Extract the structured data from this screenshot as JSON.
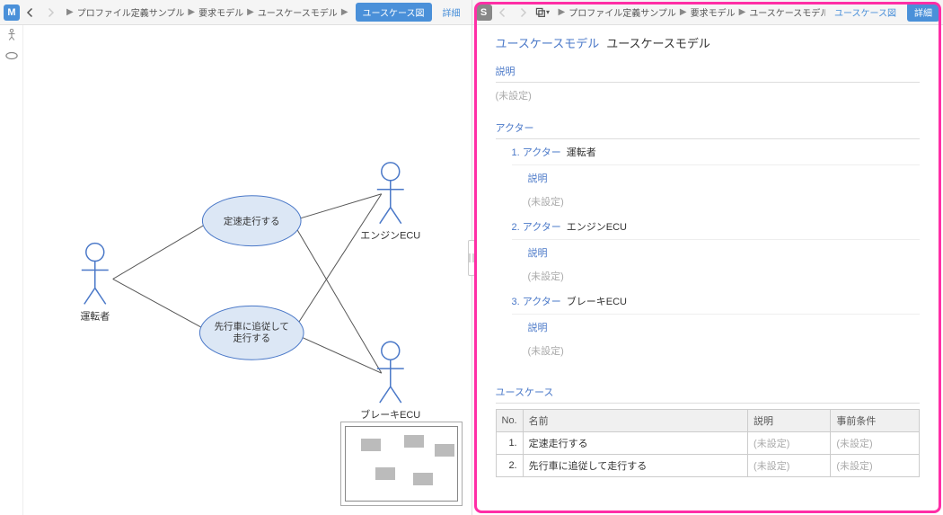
{
  "left": {
    "badge": "M",
    "breadcrumb": [
      "プロファイル定義サンプル",
      "要求モデル",
      "ユースケースモデル"
    ],
    "tab_usecase": "ユースケース図",
    "tab_detail": "詳細",
    "tab_active": "usecase"
  },
  "right": {
    "badge": "S",
    "breadcrumb": [
      "プロファイル定義サンプル",
      "要求モデル",
      "ユースケースモデル"
    ],
    "tab_usecase": "ユースケース図",
    "tab_detail": "詳細",
    "tab_active": "detail"
  },
  "diagram": {
    "actor1": "運転者",
    "actor2": "エンジンECU",
    "actor3": "ブレーキECU",
    "uc1": "定速走行する",
    "uc2_line1": "先行車に追従して",
    "uc2_line2": "走行する"
  },
  "detail": {
    "type_label": "ユースケースモデル",
    "name": "ユースケースモデル",
    "desc_label": "説明",
    "unset": "(未設定)",
    "actor_section": "アクター",
    "actors": [
      {
        "num": "1.",
        "type": "アクター",
        "name": "運転者"
      },
      {
        "num": "2.",
        "type": "アクター",
        "name": "エンジンECU"
      },
      {
        "num": "3.",
        "type": "アクター",
        "name": "ブレーキECU"
      }
    ],
    "usecase_section": "ユースケース",
    "table": {
      "col_no": "No.",
      "col_name": "名前",
      "col_desc": "説明",
      "col_pre": "事前条件",
      "rows": [
        {
          "no": "1.",
          "name": "定速走行する",
          "desc": "(未設定)",
          "pre": "(未設定)"
        },
        {
          "no": "2.",
          "name": "先行車に追従して走行する",
          "desc": "(未設定)",
          "pre": "(未設定)"
        }
      ]
    }
  }
}
